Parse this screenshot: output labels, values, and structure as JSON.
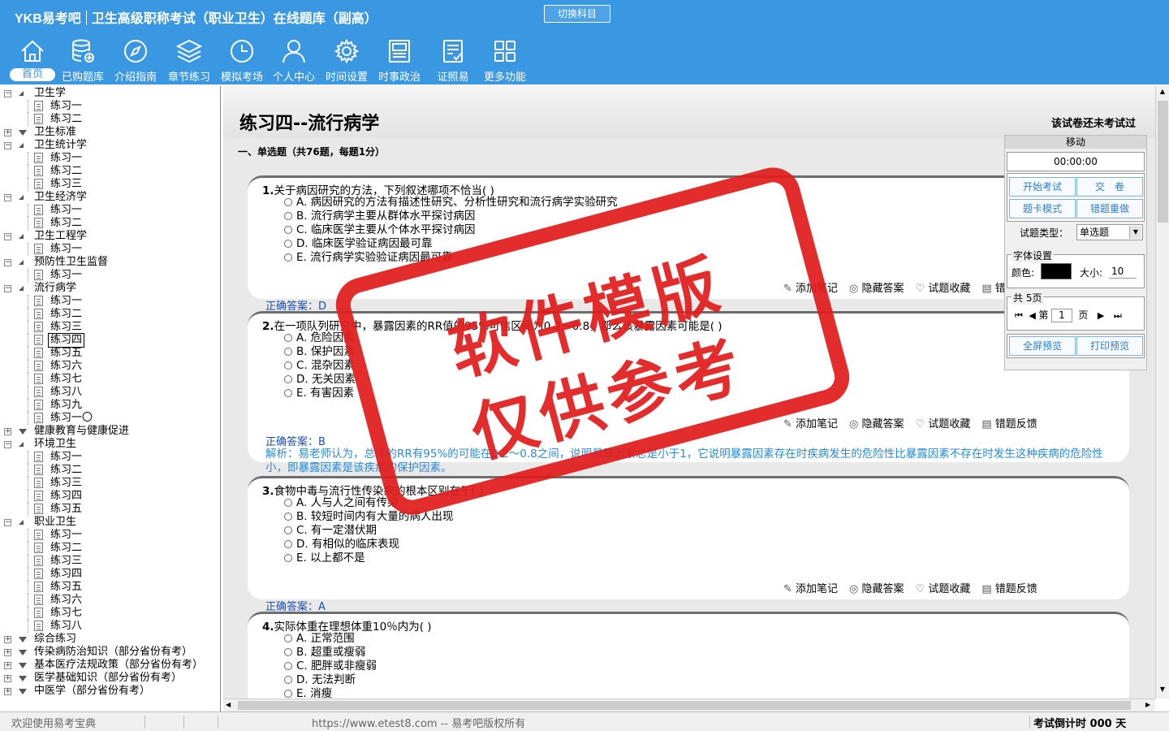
{
  "header": {
    "logo": "YKB易考吧",
    "title": "卫生高级职称考试（职业卫生）在线题库（副高）",
    "switch_label": "切换科目",
    "nav": [
      {
        "label": "首页",
        "icon": "home-icon"
      },
      {
        "label": "已购题库",
        "icon": "database-icon"
      },
      {
        "label": "介绍指南",
        "icon": "compass-icon"
      },
      {
        "label": "章节练习",
        "icon": "layers-icon"
      },
      {
        "label": "模拟考场",
        "icon": "clock-icon"
      },
      {
        "label": "个人中心",
        "icon": "user-icon"
      },
      {
        "label": "时间设置",
        "icon": "gear-icon"
      },
      {
        "label": "时事政治",
        "icon": "newspaper-icon"
      },
      {
        "label": "证照易",
        "icon": "certificate-icon"
      },
      {
        "label": "更多功能",
        "icon": "grid-icon"
      }
    ]
  },
  "tree": [
    {
      "label": "卫生学",
      "level": 0,
      "open": true
    },
    {
      "label": "练习一",
      "level": 1
    },
    {
      "label": "练习二",
      "level": 1
    },
    {
      "label": "卫生标准",
      "level": 0,
      "open": false
    },
    {
      "label": "卫生统计学",
      "level": 0,
      "open": true
    },
    {
      "label": "练习一",
      "level": 1
    },
    {
      "label": "练习二",
      "level": 1
    },
    {
      "label": "练习三",
      "level": 1
    },
    {
      "label": "卫生经济学",
      "level": 0,
      "open": true
    },
    {
      "label": "练习一",
      "level": 1
    },
    {
      "label": "练习二",
      "level": 1
    },
    {
      "label": "卫生工程学",
      "level": 0,
      "open": true
    },
    {
      "label": "练习一",
      "level": 1
    },
    {
      "label": "预防性卫生监督",
      "level": 0,
      "open": true
    },
    {
      "label": "练习一",
      "level": 1
    },
    {
      "label": "流行病学",
      "level": 0,
      "open": true
    },
    {
      "label": "练习一",
      "level": 1
    },
    {
      "label": "练习二",
      "level": 1
    },
    {
      "label": "练习三",
      "level": 1
    },
    {
      "label": "练习四",
      "level": 1,
      "selected": true
    },
    {
      "label": "练习五",
      "level": 1
    },
    {
      "label": "练习六",
      "level": 1
    },
    {
      "label": "练习七",
      "level": 1
    },
    {
      "label": "练习八",
      "level": 1
    },
    {
      "label": "练习九",
      "level": 1
    },
    {
      "label": "练习一〇",
      "level": 1
    },
    {
      "label": "健康教育与健康促进",
      "level": 0,
      "open": false
    },
    {
      "label": "环境卫生",
      "level": 0,
      "open": true
    },
    {
      "label": "练习一",
      "level": 1
    },
    {
      "label": "练习二",
      "level": 1
    },
    {
      "label": "练习三",
      "level": 1
    },
    {
      "label": "练习四",
      "level": 1
    },
    {
      "label": "练习五",
      "level": 1
    },
    {
      "label": "职业卫生",
      "level": 0,
      "open": true
    },
    {
      "label": "练习一",
      "level": 1
    },
    {
      "label": "练习二",
      "level": 1
    },
    {
      "label": "练习三",
      "level": 1
    },
    {
      "label": "练习四",
      "level": 1
    },
    {
      "label": "练习五",
      "level": 1
    },
    {
      "label": "练习六",
      "level": 1
    },
    {
      "label": "练习七",
      "level": 1
    },
    {
      "label": "练习八",
      "level": 1
    },
    {
      "label": "综合练习",
      "level": 0,
      "open": false
    },
    {
      "label": "传染病防治知识（部分省份有考）",
      "level": 0,
      "open": false
    },
    {
      "label": "基本医疗法规政策（部分省份有考）",
      "level": 0,
      "open": false
    },
    {
      "label": "医学基础知识（部分省份有考）",
      "level": 0,
      "open": false
    },
    {
      "label": "中医学（部分省份有考）",
      "level": 0,
      "open": false
    }
  ],
  "content": {
    "title": "练习四--流行病学",
    "status": "该试卷还未考试过",
    "section": "一、单选题（共76题，每题1分）",
    "actions": {
      "note": "添加笔记",
      "hide": "隐藏答案",
      "fav": "试题收藏",
      "report": "错题反馈"
    },
    "questions": [
      {
        "num": "1.",
        "text": "关于病因研究的方法，下列叙述哪项不恰当( )",
        "options": [
          "A. 病因研究的方法有描述性研究、分析性研究和流行病学实验研究",
          "B. 流行病学主要从群体水平探讨病因",
          "C. 临床医学主要从个体水平探讨病因",
          "D. 临床医学验证病因最可靠",
          "E. 流行病学实验验证病因最可靠"
        ],
        "answer": "正确答案：D"
      },
      {
        "num": "2.",
        "text": "在一项队列研究中，暴露因素的RR值的95%可信区间为0.2～0.8，那么该暴露因素可能是( )",
        "options": [
          "A. 危险因素",
          "B. 保护因素",
          "C. 混杂因素",
          "D. 无关因素",
          "E. 有害因素"
        ],
        "answer": "正确答案：B",
        "analysis": "解析：易老师认为，总体的RR有95%的可能在0.2～0.8之间，说明暴露因素总是小于1，它说明暴露因素存在时疾病发生的危险性比暴露因素不存在时发生这种疾病的危险性小，即暴露因素是该疾病的保护因素。"
      },
      {
        "num": "3.",
        "text": "食物中毒与流行性传染病的根本区别在于( )",
        "options": [
          "A. 人与人之间有传染",
          "B. 较短时间内有大量的病人出现",
          "C. 有一定潜伏期",
          "D. 有相似的临床表现",
          "E. 以上都不是"
        ],
        "answer": "正确答案：A"
      },
      {
        "num": "4.",
        "text": "实际体重在理想体重10％内为( )",
        "options": [
          "A. 正常范围",
          "B. 超重或瘦弱",
          "C. 肥胖或非瘦弱",
          "D. 无法判断",
          "E. 消瘦"
        ]
      }
    ]
  },
  "panel": {
    "move": "移动",
    "timer": "00:00:00",
    "start": "开始考试",
    "submit": "交　卷",
    "card_mode": "题卡模式",
    "redo": "错题重做",
    "type_label": "试题类型：",
    "type_value": "单选题",
    "font_legend": "字体设置",
    "color_label": "颜色:",
    "font_color": "#000000",
    "size_label": "大小:",
    "size_value": "10",
    "pages_legend": "共 5页",
    "page_prefix": "第",
    "page_value": "1",
    "page_suffix": "页",
    "fullscreen": "全屏预览",
    "print": "打印预览"
  },
  "statusbar": {
    "welcome": "欢迎使用易考宝典",
    "copyright": "https://www.etest8.com -- 易考吧版权所有",
    "countdown": "考试倒计时 000 天"
  },
  "watermark": {
    "line1": "软件模版",
    "line2": "仅供参考",
    "color": "#e11d1d"
  },
  "colors": {
    "header": "#3a97e2",
    "accent": "#2d7dd2"
  }
}
